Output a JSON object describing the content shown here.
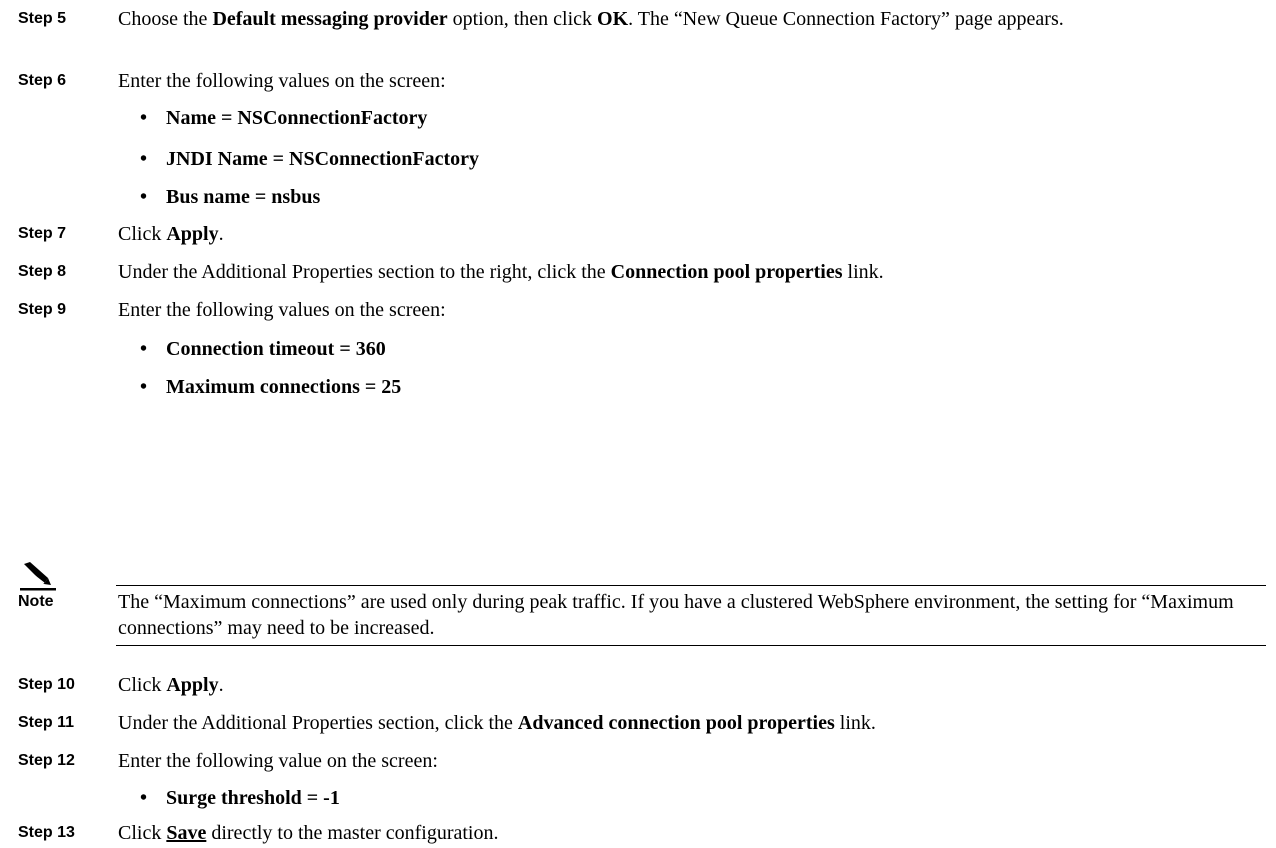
{
  "steps": {
    "s5": {
      "label": "Step 5",
      "t1": "Choose the ",
      "b1": "Default messaging provider",
      "t2": " option, then click ",
      "b2": "OK",
      "t3": ". The “New Queue Connection Factory” page appears."
    },
    "s6": {
      "label": "Step 6",
      "text": "Enter the following values on the screen:",
      "bullets": [
        "Name = NSConnectionFactory",
        "JNDI Name = NSConnectionFactory",
        "Bus name = nsbus"
      ]
    },
    "s7": {
      "label": "Step 7",
      "t1": "Click ",
      "b1": "Apply",
      "t2": "."
    },
    "s8": {
      "label": "Step 8",
      "t1": "Under the Additional Properties section to the right, click the ",
      "b1": "Connection pool properties",
      "t2": " link."
    },
    "s9": {
      "label": "Step 9",
      "text": "Enter the following values on the screen:",
      "bullets": [
        "Connection timeout = 360",
        "Maximum connections = 25"
      ]
    },
    "s10": {
      "label": "Step 10",
      "t1": "Click ",
      "b1": "Apply",
      "t2": "."
    },
    "s11": {
      "label": "Step 11",
      "t1": "Under the Additional Properties section, click the ",
      "b1": "Advanced connection pool properties",
      "t2": " link."
    },
    "s12": {
      "label": "Step 12",
      "text": "Enter the following value on the screen:",
      "bullets": [
        "Surge threshold = -1"
      ]
    },
    "s13": {
      "label": "Step 13",
      "t1": "Click ",
      "b1": "Save",
      "t2": " directly to the master configuration."
    }
  },
  "note": {
    "label": "Note",
    "text": "The “Maximum connections” are used only during peak traffic. If you have a clustered WebSphere environment, the setting for “Maximum connections” may need to be increased."
  },
  "bullet_glyph": "•",
  "icons": {
    "note": "pencil-note-icon"
  }
}
